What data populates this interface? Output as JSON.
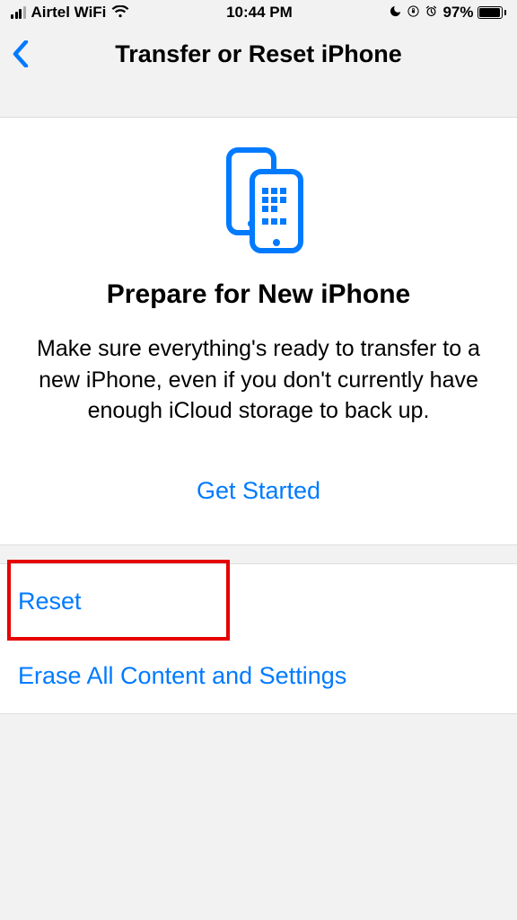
{
  "status": {
    "carrier": "Airtel WiFi",
    "time": "10:44 PM",
    "battery_pct": "97%"
  },
  "nav": {
    "title": "Transfer or Reset iPhone"
  },
  "hero": {
    "title": "Prepare for New iPhone",
    "description": "Make sure everything's ready to transfer to a new iPhone, even if you don't currently have enough iCloud storage to back up.",
    "cta": "Get Started"
  },
  "options": {
    "reset": "Reset",
    "erase": "Erase All Content and Settings"
  }
}
